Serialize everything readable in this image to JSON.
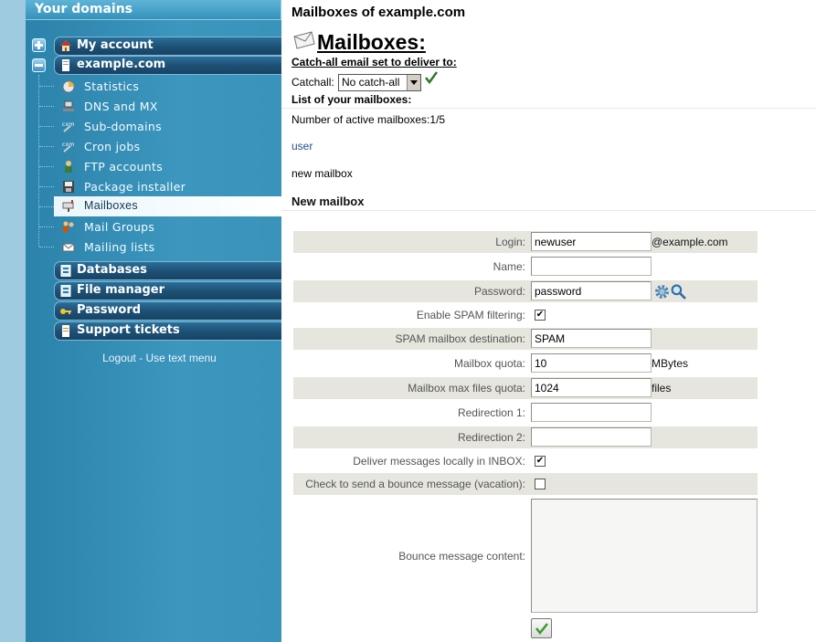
{
  "sidebar": {
    "title": "Your domains",
    "my_account": "My account",
    "domain": "example.com",
    "sub_items": [
      "Statistics",
      "DNS and MX",
      "Sub-domains",
      "Cron jobs",
      "FTP accounts",
      "Package installer",
      "Mailboxes",
      "Mail Groups",
      "Mailing lists"
    ],
    "databases": "Databases",
    "file_manager": "File manager",
    "password": "Password",
    "support_tickets": "Support tickets",
    "logout": "Logout - Use text menu"
  },
  "main": {
    "page_heading": "Mailboxes of example.com",
    "title": "Mailboxes:",
    "catchall_heading": "Catch-all email set to deliver to:",
    "catchall_label": "Catchall:",
    "catchall_value": "No catch-all",
    "list_heading": "List of your mailboxes:",
    "active_count": "Number of active mailboxes:1/5",
    "user_link": "user",
    "new_mailbox_link": "new mailbox",
    "new_mailbox_heading": "New mailbox"
  },
  "form": {
    "login_label": "Login:",
    "login_value": "newuser",
    "login_suffix": "@example.com",
    "name_label": "Name:",
    "name_value": "",
    "password_label": "Password:",
    "password_value": "password",
    "spam_label": "Enable SPAM filtering:",
    "spam_checked": true,
    "spam_dest_label": "SPAM mailbox destination:",
    "spam_dest_value": "SPAM",
    "quota_label": "Mailbox quota:",
    "quota_value": "10",
    "quota_unit": "MBytes",
    "maxfiles_label": "Mailbox max files quota:",
    "maxfiles_value": "1024",
    "maxfiles_unit": "files",
    "redir1_label": "Redirection 1:",
    "redir1_value": "",
    "redir2_label": "Redirection 2:",
    "redir2_value": "",
    "deliver_label": "Deliver messages locally in INBOX:",
    "deliver_checked": true,
    "vacation_label": "Check to send a bounce message (vacation):",
    "vacation_checked": false,
    "bounce_label": "Bounce message content:",
    "bounce_value": ""
  },
  "icons": {
    "plus": "plus-toggle-icon",
    "minus": "minus-toggle-icon",
    "home": "home-icon",
    "page": "page-icon",
    "stats": "pie-chart-icon",
    "dns": "network-icon",
    "com": "com-icon",
    "user": "user-icon",
    "package": "floppy-icon",
    "mailbox": "mailbox-icon",
    "group": "group-icon",
    "envelope": "envelope-icon",
    "database": "database-icon",
    "key": "key-icon",
    "gear": "gear-icon",
    "magnifier": "magnifier-icon",
    "check": "checkmark-icon"
  },
  "colors": {
    "sidebar": "#3a93ba",
    "sidebar_dark": "#1d4f73",
    "row_shade": "#e6e6de",
    "link": "#1e4e8c"
  }
}
